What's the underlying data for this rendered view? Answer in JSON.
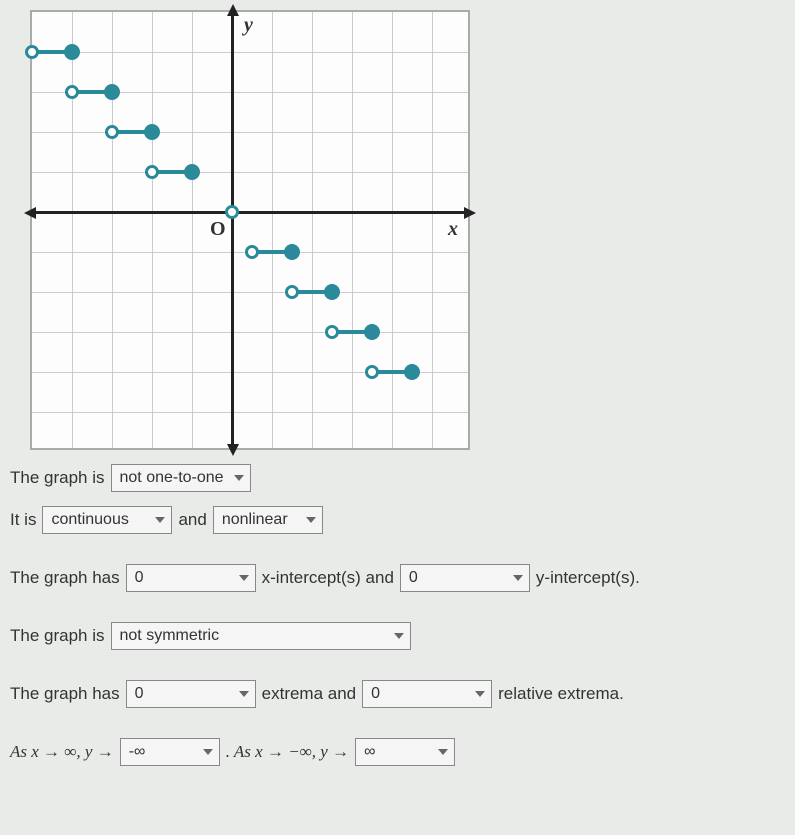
{
  "chart_data": {
    "type": "scatter",
    "title": "",
    "xlabel": "x",
    "ylabel": "y",
    "origin": "O",
    "xlim": [
      -5,
      6
    ],
    "ylim": [
      -5,
      6
    ],
    "segments": [
      {
        "x_open": -5,
        "x_closed": -4,
        "y": 4
      },
      {
        "x_open": -4,
        "x_closed": -3,
        "y": 3
      },
      {
        "x_open": -3,
        "x_closed": -2,
        "y": 2
      },
      {
        "x_open": -2,
        "x_closed": -1,
        "y": 1
      },
      {
        "x_open": 0,
        "x_closed": 1,
        "y": -1
      },
      {
        "x_open": 1,
        "x_closed": 2,
        "y": -2
      },
      {
        "x_open": 2,
        "x_closed": 3,
        "y": -3
      },
      {
        "x_open": 3,
        "x_closed": 4,
        "y": -4
      }
    ],
    "origin_open_point": {
      "x": 0,
      "y": 0
    }
  },
  "statements": {
    "s1_prefix": "The graph is",
    "s1_select": "not one-to-one",
    "s2_prefix": "It is",
    "s2_select_a": "continuous",
    "s2_mid": "and",
    "s2_select_b": "nonlinear",
    "s3_prefix": "The graph has",
    "s3_select_a": "0",
    "s3_mid_a": "x-intercept(s) and",
    "s3_select_b": "0",
    "s3_suffix": "y-intercept(s).",
    "s4_prefix": "The graph is",
    "s4_select": "not symmetric",
    "s5_prefix": "The graph has",
    "s5_select_a": "0",
    "s5_mid": "extrema and",
    "s5_select_b": "0",
    "s5_suffix": "relative extrema.",
    "s6_prefix_a": "As x → ∞, y →",
    "s6_select_a": "-∞",
    "s6_mid": ". As x → −∞, y →",
    "s6_select_b": "∞"
  }
}
